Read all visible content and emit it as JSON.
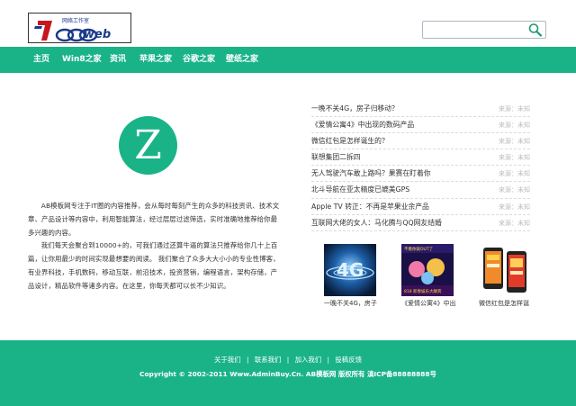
{
  "site": {
    "logo_text": "7000web",
    "logo_subtext": "网络工作室"
  },
  "search": {
    "value": "",
    "placeholder": ""
  },
  "nav": {
    "items": [
      {
        "label": "主页"
      },
      {
        "label": "Win8之家"
      },
      {
        "label": "资讯"
      },
      {
        "label": "苹果之家"
      },
      {
        "label": "谷歌之家"
      },
      {
        "label": "壁纸之家"
      }
    ]
  },
  "about": {
    "logo_letter": "Z",
    "paragraph1": "AB模板网专注于IT圈的内容推荐，会从每时每刻产生的众多的科技资讯、技术文章、产品设计等内容中，利用智能算法，经过层层过滤筛选，实时准确地推荐给你最多兴趣的内容。",
    "paragraph2": "我们每天会聚合到10000+的，可我们通过还算牛逼的算法只推荐给你几十上百篇，让你用最少的时间实现最想要的阅读。 我们聚合了众多大大小小的专业性博客，有业界科技，手机数码，移动互联，前沿技术，投资营销，编程语言，架构存储，产品设计，精品软件等诸多内容。在这里，你每天都可以长不少知识。"
  },
  "news": [
    {
      "title": "一晚不关4G，房子归移动？",
      "source": "来源：未知"
    },
    {
      "title": "《爱情公寓4》中出现的数码产品",
      "source": "来源：未知"
    },
    {
      "title": "微信红包是怎样诞生的？",
      "source": "来源：未知"
    },
    {
      "title": "联想集团二拆四",
      "source": "来源：未知"
    },
    {
      "title": "无人驾驶汽车敢上路吗？果赛在盯着你",
      "source": "来源：未知"
    },
    {
      "title": "北斗导航在亚太精度已媲美GPS",
      "source": "来源：未知"
    },
    {
      "title": "Apple TV 转正：不再是苹果业余产品",
      "source": "来源：未知"
    },
    {
      "title": "互联网大佬的女人：马化腾与QQ网友结婚",
      "source": "来源：未知"
    }
  ],
  "thumbs": [
    {
      "caption": "一晚不关4G，房子"
    },
    {
      "caption": "《爱情公寓4》中出"
    },
    {
      "caption": "微信红包是怎样诞"
    }
  ],
  "thumb_texts": {
    "t2_top": "不看你就OUT了",
    "t2_bottom": "818 新春娱乐大酬宾"
  },
  "footer": {
    "links": [
      {
        "label": "关于我们"
      },
      {
        "label": "联系我们"
      },
      {
        "label": "加入我们"
      },
      {
        "label": "投稿反馈"
      }
    ],
    "separator": "|",
    "copyright": "Copyright © 2002-2011 Www.AdminBuy.Cn. AB模板网 版权所有 滇ICP备88888888号"
  },
  "colors": {
    "accent": "#1ab388",
    "text": "#333333",
    "muted": "#bbbbbb"
  },
  "icons": {
    "search": "search-icon"
  }
}
